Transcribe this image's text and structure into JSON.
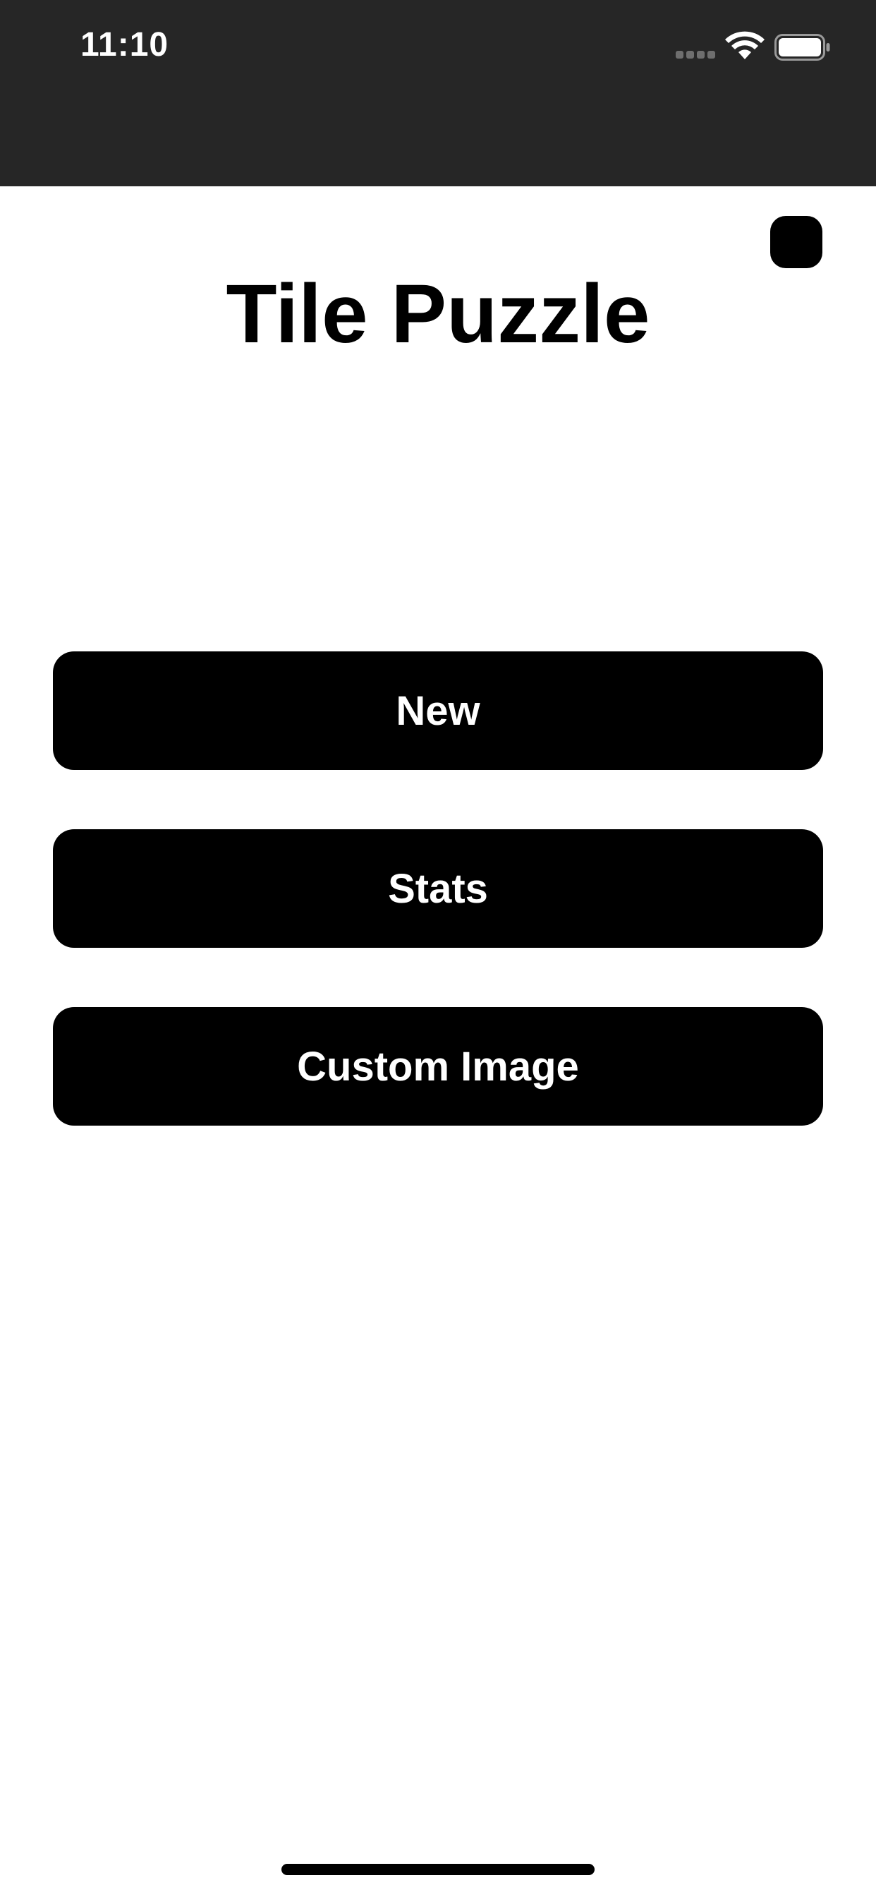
{
  "status_bar": {
    "time": "11:10",
    "signal_icon": "cellular-signal-icon",
    "wifi_icon": "wifi-icon",
    "battery_icon": "battery-icon"
  },
  "header": {
    "title": "Tile Puzzle",
    "corner_button_icon": "rounded-square-icon"
  },
  "menu": {
    "new_label": "New",
    "stats_label": "Stats",
    "custom_image_label": "Custom Image"
  },
  "colors": {
    "status_bar_background": "#262626",
    "page_background": "#ffffff",
    "button_background": "#000000",
    "button_text": "#ffffff",
    "title_text": "#000000"
  }
}
